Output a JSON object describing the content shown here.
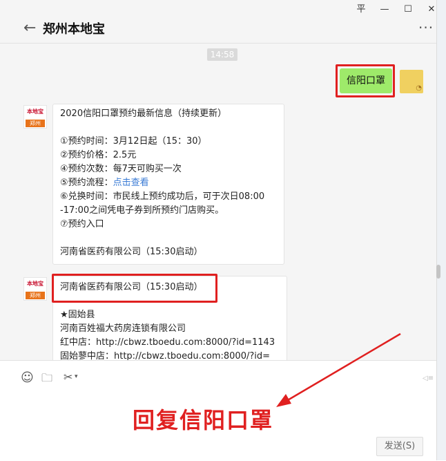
{
  "window": {
    "title": "郑州本地宝",
    "controls": {
      "pin": "平",
      "minimize": "—",
      "maximize": "☐",
      "close": "✕"
    },
    "back_glyph": "←",
    "more_glyph": "···"
  },
  "chat": {
    "timestamp": "14:58",
    "self_message": "信阳口罩",
    "bot_avatar": {
      "top_text": "本地宝",
      "bottom_text": "郑州"
    },
    "message1_lines": [
      "2020信阳口罩预约最新信息（持续更新）",
      "",
      "①预约时间：3月12日起（15：30）",
      "②预约价格：2.5元",
      "④预约次数：每7天可购买一次",
      "⑤预约流程：",
      "⑥兑换时间：市民线上预约成功后，可于次日08:00",
      "-17:00之间凭电子券到所预约门店购买。",
      "⑦预约入口",
      "",
      "河南省医药有限公司（15:30启动）"
    ],
    "message1_link": "点击查看",
    "message2_lines": [
      "河南省医药有限公司（15:30启动）",
      "",
      "★固始县",
      "河南百姓福大药房连锁有限公司",
      "红中店：http://cbwz.tboedu.com:8000/?id=1143",
      "固始蓼中店：http://cbwz.tboedu.com:8000/?id="
    ]
  },
  "toolbar": {
    "emoji_icon": "☺",
    "folder_icon": "🗀",
    "scissors_icon": "✂",
    "send_label": "发送(S)"
  },
  "annotation": {
    "text": "回复信阳口罩",
    "color": "#e02020"
  }
}
